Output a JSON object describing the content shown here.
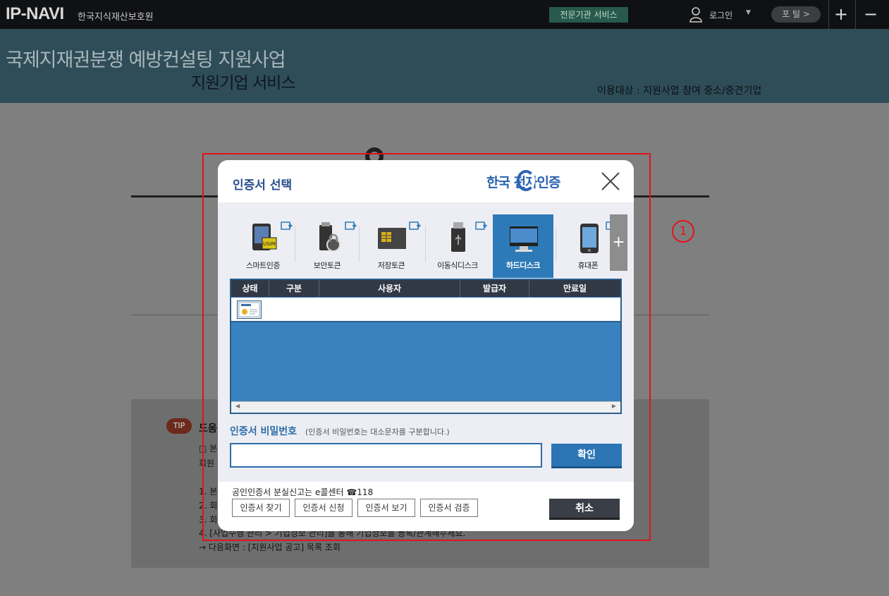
{
  "topbar": {
    "logo": "IP-NAVI",
    "org": "한국지식재산보호원",
    "expert_service": "전문기관 서비스",
    "login": "로그인",
    "portal": "포 털 >",
    "zoom_in": "+",
    "zoom_out": "−"
  },
  "banner": {
    "title": "국제지재권분쟁 예방컨설팅 지원사업",
    "subtitle": "지원기업 서비스",
    "target": "이용대상 : 지원사업 참여 중소/중견기업"
  },
  "tip": {
    "badge": "TIP",
    "title": "도움",
    "lines": [
      "□ 본",
      "회원",
      "1. 본",
      "2. 회",
      "3. 회",
      "4. [사업수행 관리 > 기업정보 관리]를 통해 기업정보를 등록/관계해주세요.",
      "→ 다음화면 : [지원사업 공고] 목록 조회"
    ]
  },
  "annotation": "1",
  "dialog": {
    "title": "인증서 선택",
    "brand": "한국 전자인증",
    "media_tabs": [
      {
        "label": "스마트인증",
        "icon": "smart-auth-icon"
      },
      {
        "label": "보안토큰",
        "icon": "security-token-icon"
      },
      {
        "label": "저장토큰",
        "icon": "storage-token-icon"
      },
      {
        "label": "이동식디스크",
        "icon": "usb-disk-icon"
      },
      {
        "label": "하드디스크",
        "icon": "hard-disk-icon",
        "selected": true
      },
      {
        "label": "휴대폰",
        "icon": "mobile-phone-icon"
      }
    ],
    "more": "+",
    "columns": [
      "상태",
      "구분",
      "사용자",
      "발급자",
      "만료일"
    ],
    "rows": [
      {
        "status_icon": "certificate-icon",
        "type": "",
        "user": "",
        "issuer": "",
        "expiry": ""
      }
    ],
    "password_label": "인증서 비밀번호",
    "password_hint": "(인증서 비밀번호는 대소문자를 구분합니다.)",
    "password_value": "",
    "confirm": "확인",
    "lost_notice": "공인인증서 분실신고는 e콜센터 ☎118",
    "footer_buttons": [
      "인증서 찾기",
      "인증서 신청",
      "인증서 보기",
      "인증서 검증"
    ],
    "cancel": "취소"
  },
  "colors": {
    "accent": "#2d7ab8",
    "table_bg": "#3a82bf",
    "header_dark": "#313846",
    "annotation_red": "#e0141c"
  }
}
